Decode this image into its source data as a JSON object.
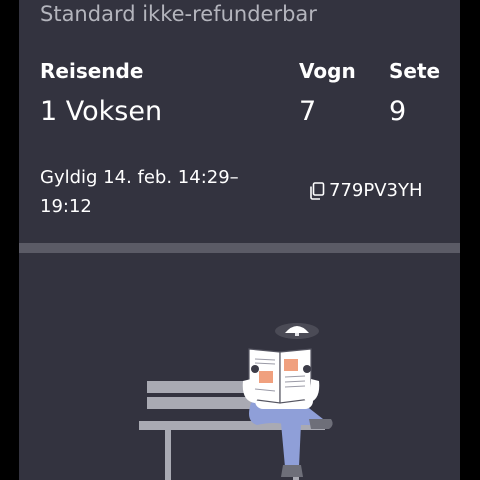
{
  "ticket": {
    "subtitle": "Standard ikke-refunderbar",
    "travelers_label": "Reisende",
    "travelers_value": "1 Voksen",
    "car_label": "Vogn",
    "car_value": "7",
    "seat_label": "Sete",
    "seat_value": "9",
    "validity_text": "Gyldig 14. feb. 14:29–19:12",
    "reference_code": "779PV3YH"
  },
  "icons": {
    "copy": "copy-icon",
    "illustration": "person-reading-newspaper-on-bench"
  },
  "colors": {
    "card_background": "#33333f",
    "divider": "#5b5b66",
    "subtitle_text": "#b4b5bd",
    "text": "#ffffff",
    "bench": "#a9aab3",
    "jeans": "#8f9fd8",
    "newspaper_highlight": "#f0a07e"
  }
}
